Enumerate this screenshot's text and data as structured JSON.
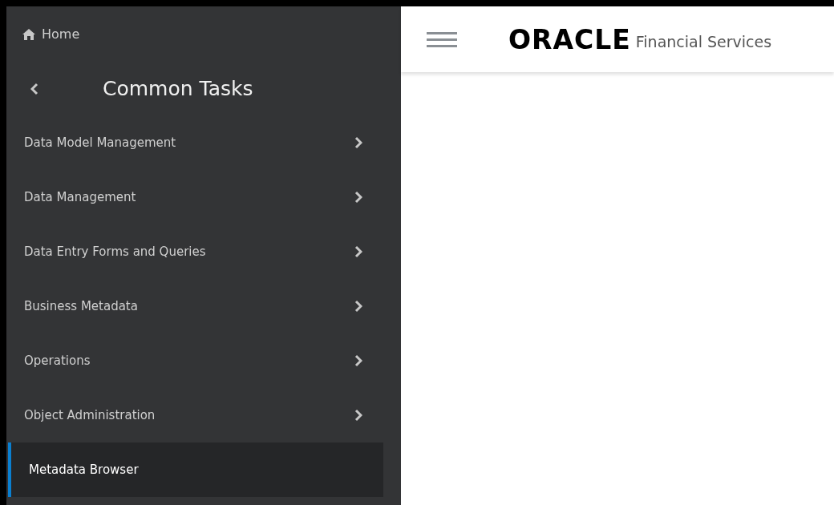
{
  "sidebar": {
    "home": "Home",
    "title": "Common Tasks",
    "items": [
      {
        "label": "Data Model Management",
        "expandable": true,
        "selected": false
      },
      {
        "label": "Data Management",
        "expandable": true,
        "selected": false
      },
      {
        "label": "Data Entry Forms and Queries",
        "expandable": true,
        "selected": false
      },
      {
        "label": "Business Metadata",
        "expandable": true,
        "selected": false
      },
      {
        "label": "Operations",
        "expandable": true,
        "selected": false
      },
      {
        "label": "Object Administration",
        "expandable": true,
        "selected": false
      },
      {
        "label": "Metadata Browser",
        "expandable": false,
        "selected": true
      }
    ]
  },
  "header": {
    "logo": "ORACLE",
    "product": "Financial Services"
  }
}
